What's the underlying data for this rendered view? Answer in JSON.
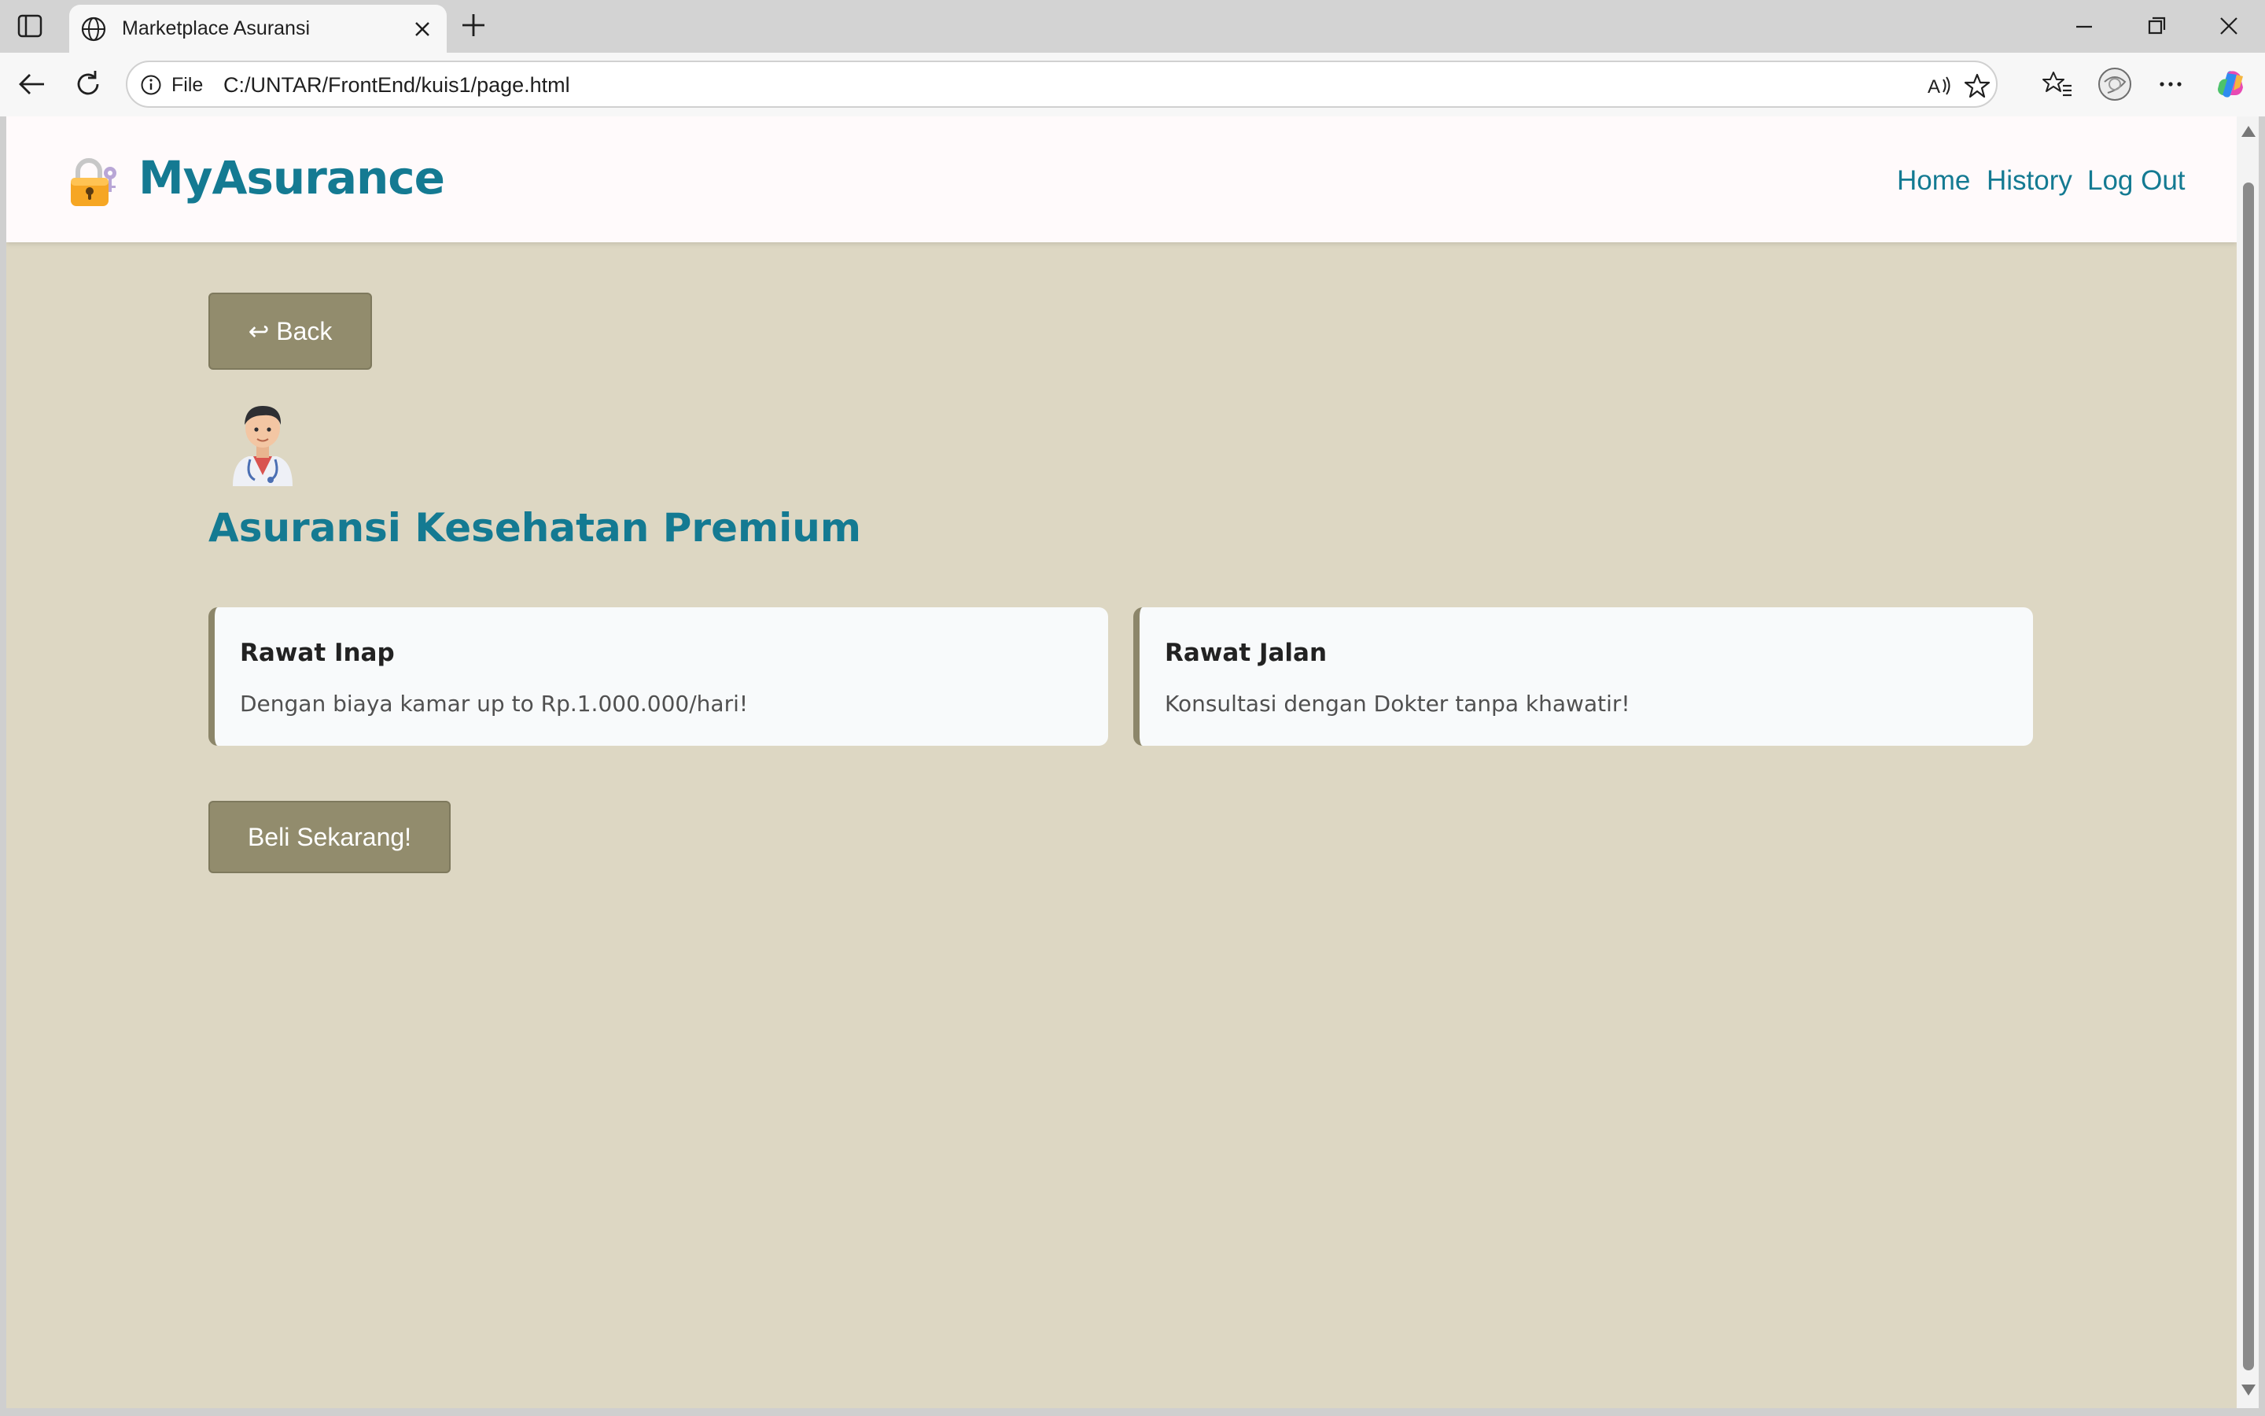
{
  "browser": {
    "tab_title": "Marketplace Asuransi",
    "address_scheme": "File",
    "address_url": "C:/UNTAR/FrontEnd/kuis1/page.html"
  },
  "header": {
    "logo_icon": "padlock-key-icon",
    "brand": "MyAsurance",
    "nav": [
      "Home",
      "History",
      "Log Out"
    ]
  },
  "page": {
    "back_label": "↩ Back",
    "illustration": "doctor-icon",
    "heading": "Asuransi Kesehatan Premium",
    "cards": [
      {
        "title": "Rawat Inap",
        "description": "Dengan biaya kamar up to Rp.1.000.000/hari!"
      },
      {
        "title": "Rawat Jalan",
        "description": "Konsultasi dengan Dokter tanpa khawatir!"
      }
    ],
    "buy_label": "Beli Sekarang!"
  },
  "colors": {
    "brand": "#147a92",
    "page_background": "#ddd7c3",
    "button": "#928c6d",
    "card_border": "#8c866a"
  }
}
